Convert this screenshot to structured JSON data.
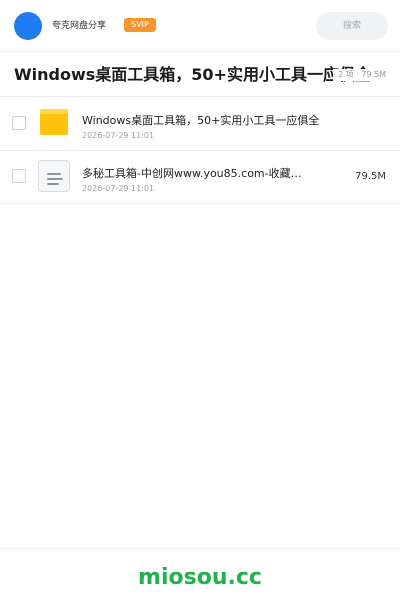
{
  "header": {
    "username": "夸克网盘分享",
    "badge": "SVIP",
    "search_placeholder": "搜索"
  },
  "share": {
    "title": "Windows桌面工具箱，50+实用小工具一应俱全",
    "meta": "· 2 项 · 79.5M"
  },
  "files": [
    {
      "name": "Windows桌面工具箱，50+实用小工具一应俱全",
      "date": "2026-07-29 11:01",
      "size": "",
      "type": "folder"
    },
    {
      "name": "多秘工具箱-中创网www.you85.com-收藏…",
      "date": "2026-07-29 11:01",
      "size": "79.5M",
      "type": "file"
    }
  ],
  "footer": {
    "brand": "miosou.cc"
  },
  "colors": {
    "accent": "#1e7bf0",
    "badge": "#f5962e",
    "folder": "#ffc20e",
    "brand": "#22b14c"
  }
}
